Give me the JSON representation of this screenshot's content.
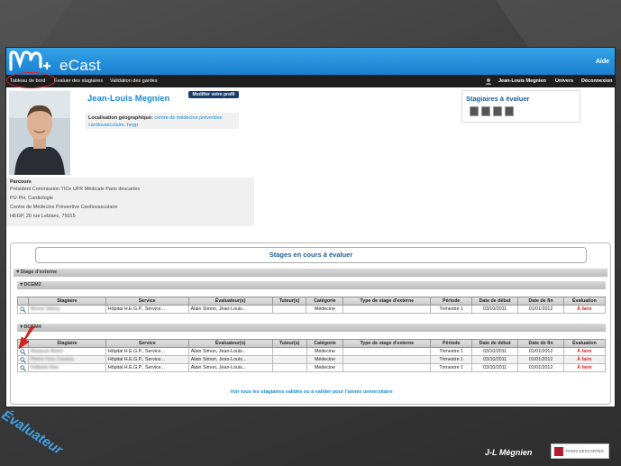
{
  "header": {
    "app_name": "eCast",
    "help_label": "Aide"
  },
  "nav": {
    "dashboard": "Tableau de bord",
    "evaluate_trainees": "Évaluer des stagiaires",
    "validate_guards": "Validation des gardes",
    "user": "Jean-Louis Megnien",
    "universe": "Univers",
    "logout": "Déconnexion"
  },
  "profile": {
    "name": "Jean-Louis Megnien",
    "edit_label": "Modifier votre profil",
    "location_label": "Localisation géographique:",
    "location_value": "centre de médecine préventive cardiovasculaire, hegp",
    "parcours_title": "Parcours",
    "parcours_lines": [
      "Président Commission TICe UFR Médicale Paris descartes",
      "PU-PH, Cardiologie",
      "Centre de Médecine Préventive Cardiovasculaire",
      "HEGP, 20 rue Leblanc, 75015"
    ]
  },
  "trainees_box": {
    "title": "Stagiaires à évaluer"
  },
  "stages": {
    "title": "Stages en cours à évaluer",
    "section": "▼Stage d'externe",
    "group1": "▼DCEM2",
    "group2": "▼DCEM4",
    "columns": [
      "Stagiaire",
      "Service",
      "Évaluateur(s)",
      "Tuteur(s)",
      "Catégorie",
      "Type de stage d'externe",
      "Période",
      "Date de début",
      "Date de fin",
      "Évaluation"
    ],
    "group1_rows": [
      {
        "stagiaire": "Benne Sidney",
        "service": "Hôpital H.E.G.P., Service...",
        "evaluateur": "Alain Simon, Jean-Louis...",
        "tuteur": "",
        "categorie": "Médecine",
        "type": "",
        "periode": "Trimestre 1",
        "debut": "03/10/2011",
        "fin": "01/01/2012",
        "evaluation": "À faire"
      }
    ],
    "group2_rows": [
      {
        "stagiaire": "Mahjoub Alisée",
        "service": "Hôpital H.E.G.P., Service...",
        "evaluateur": "Alain Simon, Jean-Louis...",
        "tuteur": "",
        "categorie": "Médecine",
        "type": "",
        "periode": "Trimestre 1",
        "debut": "03/10/2011",
        "fin": "01/01/2012",
        "evaluation": "À faire"
      },
      {
        "stagiaire": "Pierre-Yves Cavaroc",
        "service": "Hôpital H.E.G.P., Service...",
        "evaluateur": "Alain Simon, Jean-Louis...",
        "tuteur": "",
        "categorie": "Médecine",
        "type": "",
        "periode": "Trimestre 1",
        "debut": "03/10/2011",
        "fin": "01/01/2012",
        "evaluation": "À faire"
      },
      {
        "stagiaire": "Raffaele Alan",
        "service": "Hôpital H.E.G.P., Service...",
        "evaluateur": "Alain Simon, Jean-Louis...",
        "tuteur": "",
        "categorie": "Médecine",
        "type": "",
        "periode": "Trimestre 1",
        "debut": "03/10/2011",
        "fin": "01/01/2012",
        "evaluation": "À faire"
      }
    ],
    "all_link": "Voir tous les stagiaires validés ou à valider pour l'année universitaire"
  },
  "slide": {
    "label": "Évaluateur",
    "author": "J-L Mégnien",
    "logo_text": "PARIS DESCARTES"
  },
  "colors": {
    "banner": "#1a7fd0",
    "accent_red": "#d8252a",
    "title_blue": "#1a5e99"
  }
}
